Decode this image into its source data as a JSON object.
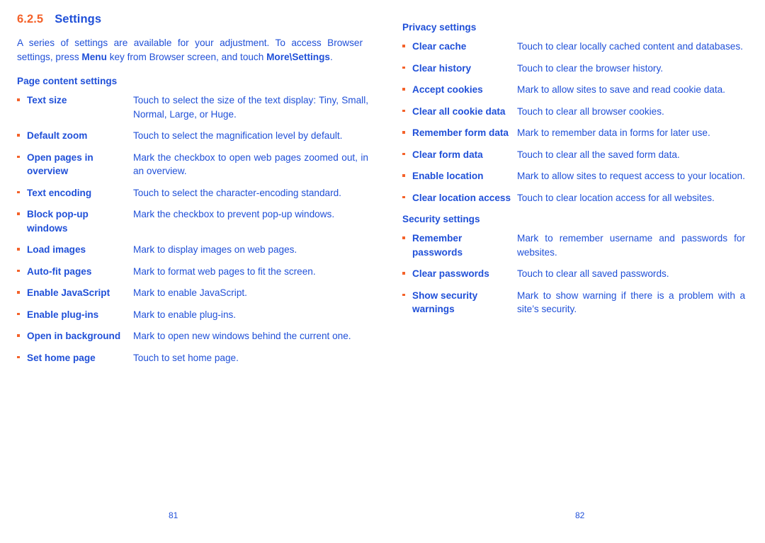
{
  "colors": {
    "accent_orange": "#f4622a",
    "text_blue": "#2050d8",
    "background": "#ffffff"
  },
  "left_page": {
    "section_number": "6.2.5",
    "section_title": "Settings",
    "intro": {
      "part1": "A series of settings are available for your adjustment. To access Browser settings, press ",
      "bold1": "Menu",
      "part2": " key from Browser screen, and touch ",
      "bold2": "More\\",
      "bold3": "Settings",
      "part3": "."
    },
    "subheading": "Page content settings",
    "items": [
      {
        "term": "Text size",
        "desc": "Touch to select the size of the text display: Tiny, Small, Normal, Large, or Huge.",
        "multiline": true
      },
      {
        "term": "Default zoom",
        "desc": "Touch to select the magnification level by default.",
        "multiline": false
      },
      {
        "term": "Open pages in overview",
        "desc": "Mark the checkbox to open web pages zoomed out, in an overview.",
        "multiline": true
      },
      {
        "term": "Text encoding",
        "desc": "Touch to select the character-encoding standard.",
        "multiline": false
      },
      {
        "term": "Block pop-up windows",
        "desc": "Mark the checkbox to prevent pop-up windows.",
        "multiline": false
      },
      {
        "term": "Load images",
        "desc": "Mark to display images on web pages.",
        "multiline": false
      },
      {
        "term": "Auto-fit pages",
        "desc": "Mark to format web pages to fit the screen.",
        "multiline": false
      },
      {
        "term": "Enable JavaScript",
        "desc": "Mark to enable JavaScript.",
        "multiline": false
      },
      {
        "term": "Enable plug-ins",
        "desc": "Mark to enable plug-ins.",
        "multiline": false
      },
      {
        "term": "Open in background",
        "desc": "Mark to open new windows behind the current one.",
        "multiline": true
      },
      {
        "term": "Set home page",
        "desc": "Touch to set home page.",
        "multiline": false
      }
    ],
    "folio": "81"
  },
  "right_page": {
    "privacy_heading": "Privacy settings",
    "privacy_items": [
      {
        "term": "Clear cache",
        "desc": "Touch to clear locally cached content and databases.",
        "multiline": true
      },
      {
        "term": "Clear history",
        "desc": "Touch to clear the browser history.",
        "multiline": false
      },
      {
        "term": "Accept cookies",
        "desc": "Mark to allow sites to save and read cookie data.",
        "multiline": false
      },
      {
        "term": "Clear all cookie data",
        "desc": "Touch to clear all browser cookies.",
        "multiline": false
      },
      {
        "term": "Remember form data",
        "desc": "Mark to remember data in forms for later use.",
        "multiline": false
      },
      {
        "term": "Clear form data",
        "desc": "Touch to clear all the saved form data.",
        "multiline": false
      },
      {
        "term": "Enable location",
        "desc": "Mark to allow sites to request access to your location.",
        "multiline": true
      },
      {
        "term": "Clear location access",
        "desc": "Touch to clear location access for all websites.",
        "multiline": false
      }
    ],
    "security_heading": "Security settings",
    "security_items": [
      {
        "term": "Remember passwords",
        "desc": "Mark to remember username and passwords for websites.",
        "multiline": true
      },
      {
        "term": "Clear passwords",
        "desc": "Touch to clear all saved passwords.",
        "multiline": false
      },
      {
        "term": "Show security warnings",
        "desc": "Mark to show warning if there is a problem with a site’s security.",
        "multiline": true
      }
    ],
    "folio": "82"
  }
}
